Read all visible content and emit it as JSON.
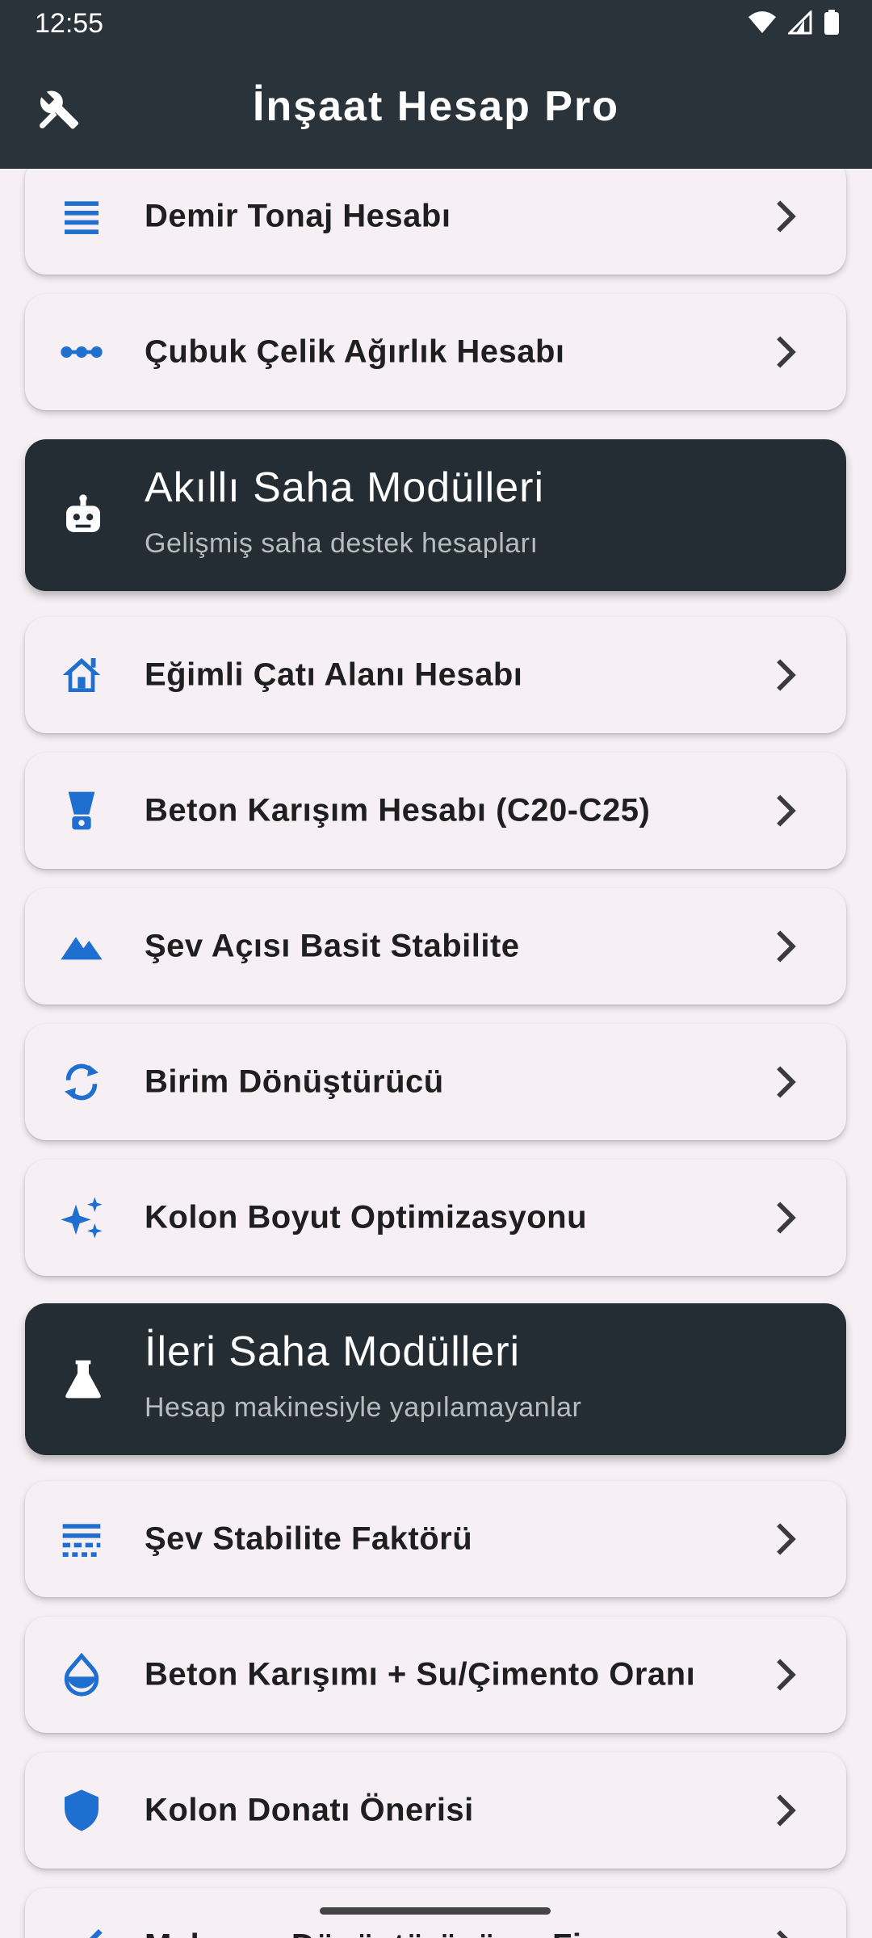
{
  "status": {
    "time": "12:55"
  },
  "app": {
    "title": "İnşaat Hesap Pro"
  },
  "colors": {
    "accent": "#1e6fcf",
    "header_bg": "#2a323a",
    "section_bg": "#252d34"
  },
  "items": [
    {
      "label": "Demir Tonaj Hesabı",
      "icon": "list-lines-icon"
    },
    {
      "label": "Çubuk Çelik Ağırlık Hesabı",
      "icon": "dots-line-icon"
    },
    {
      "label": "Eğimli Çatı Alanı Hesabı",
      "icon": "roof-home-icon"
    },
    {
      "label": "Beton Karışım Hesabı (C20-C25)",
      "icon": "blender-icon"
    },
    {
      "label": "Şev Açısı Basit Stabilite",
      "icon": "mountain-icon"
    },
    {
      "label": "Birim Dönüştürücü",
      "icon": "sync-icon"
    },
    {
      "label": "Kolon Boyut Optimizasyonu",
      "icon": "sparkle-icon"
    },
    {
      "label": "Şev Stabilite Faktörü",
      "icon": "grid-layers-icon"
    },
    {
      "label": "Beton Karışımı + Su/Çimento Oranı",
      "icon": "water-drop-icon"
    },
    {
      "label": "Kolon Donatı Önerisi",
      "icon": "shield-icon"
    },
    {
      "label": "Malzeme Dönüştürücü ve Fi...",
      "icon": "ruler-icon"
    }
  ],
  "sections": [
    {
      "title": "Akıllı Saha Modülleri",
      "subtitle": "Gelişmiş saha destek hesapları",
      "icon": "robot-icon"
    },
    {
      "title": "İleri Saha Modülleri",
      "subtitle": "Hesap makinesiyle yapılamayanlar",
      "icon": "flask-icon"
    }
  ]
}
